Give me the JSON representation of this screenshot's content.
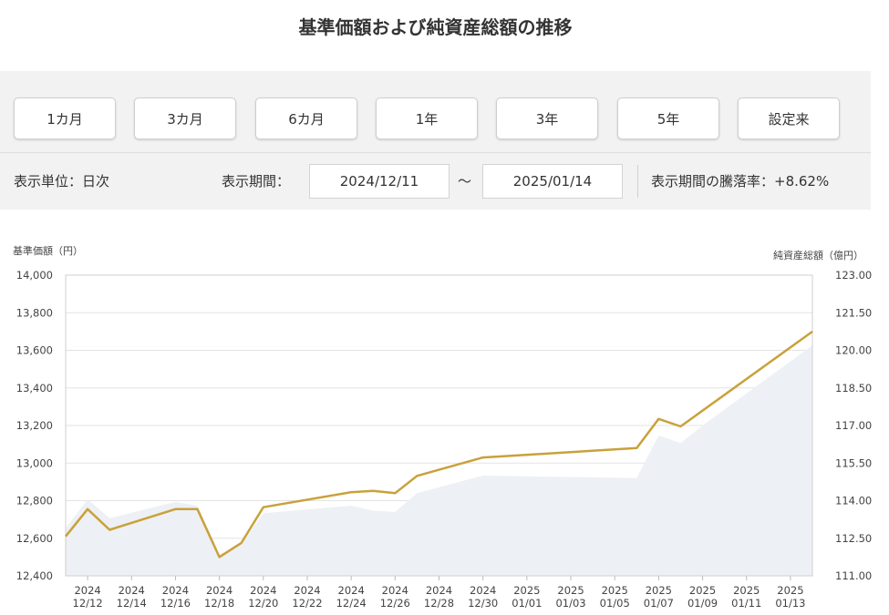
{
  "page": {
    "title": "基準価額および純資産総額の推移"
  },
  "period_buttons": [
    {
      "label": "1カ月"
    },
    {
      "label": "3カ月"
    },
    {
      "label": "6カ月"
    },
    {
      "label": "1年"
    },
    {
      "label": "3年"
    },
    {
      "label": "5年"
    },
    {
      "label": "設定来"
    }
  ],
  "controls": {
    "unit_label": "表示単位：日次",
    "period_label": "表示期間：",
    "start_date": "2024/12/11",
    "tilde": "～",
    "end_date": "2025/01/14",
    "change_label": "表示期間の騰落率：+8.62%"
  },
  "colors": {
    "nav_line": "#c9a13b",
    "net_assets_area": "#edf0f4",
    "grid": "#e3e3e3"
  },
  "chart_data": {
    "type": "line",
    "ylabel": "基準価額（円）",
    "y2label": "純資産総額（億円）",
    "ylim": [
      12400,
      14000
    ],
    "y2lim": [
      111.0,
      123.0
    ],
    "yticks": [
      "12,400",
      "12,600",
      "12,800",
      "13,000",
      "13,200",
      "13,400",
      "13,600",
      "13,800",
      "14,000"
    ],
    "y2ticks": [
      "111.00",
      "112.50",
      "114.00",
      "115.50",
      "117.00",
      "118.50",
      "120.00",
      "121.50",
      "123.00"
    ],
    "xticks": [
      {
        "date": "2024-12-12",
        "year": "2024",
        "md": "12/12"
      },
      {
        "date": "2024-12-14",
        "year": "2024",
        "md": "12/14"
      },
      {
        "date": "2024-12-16",
        "year": "2024",
        "md": "12/16"
      },
      {
        "date": "2024-12-18",
        "year": "2024",
        "md": "12/18"
      },
      {
        "date": "2024-12-20",
        "year": "2024",
        "md": "12/20"
      },
      {
        "date": "2024-12-22",
        "year": "2024",
        "md": "12/22"
      },
      {
        "date": "2024-12-24",
        "year": "2024",
        "md": "12/24"
      },
      {
        "date": "2024-12-26",
        "year": "2024",
        "md": "12/26"
      },
      {
        "date": "2024-12-28",
        "year": "2024",
        "md": "12/28"
      },
      {
        "date": "2024-12-30",
        "year": "2024",
        "md": "12/30"
      },
      {
        "date": "2025-01-01",
        "year": "2025",
        "md": "01/01"
      },
      {
        "date": "2025-01-03",
        "year": "2025",
        "md": "01/03"
      },
      {
        "date": "2025-01-05",
        "year": "2025",
        "md": "01/05"
      },
      {
        "date": "2025-01-07",
        "year": "2025",
        "md": "01/07"
      },
      {
        "date": "2025-01-09",
        "year": "2025",
        "md": "01/09"
      },
      {
        "date": "2025-01-11",
        "year": "2025",
        "md": "01/11"
      },
      {
        "date": "2025-01-13",
        "year": "2025",
        "md": "01/13"
      }
    ],
    "xrange": [
      "2024-12-11",
      "2025-01-14"
    ],
    "series": [
      {
        "name": "基準価額",
        "axis": "left",
        "kind": "line",
        "points": [
          {
            "x": "2024-12-11",
            "y": 12610
          },
          {
            "x": "2024-12-12",
            "y": 12755
          },
          {
            "x": "2024-12-13",
            "y": 12645
          },
          {
            "x": "2024-12-16",
            "y": 12755
          },
          {
            "x": "2024-12-17",
            "y": 12755
          },
          {
            "x": "2024-12-18",
            "y": 12500
          },
          {
            "x": "2024-12-19",
            "y": 12575
          },
          {
            "x": "2024-12-20",
            "y": 12765
          },
          {
            "x": "2024-12-24",
            "y": 12845
          },
          {
            "x": "2024-12-25",
            "y": 12852
          },
          {
            "x": "2024-12-26",
            "y": 12840
          },
          {
            "x": "2024-12-27",
            "y": 12932
          },
          {
            "x": "2024-12-30",
            "y": 13030
          },
          {
            "x": "2025-01-06",
            "y": 13080
          },
          {
            "x": "2025-01-07",
            "y": 13235
          },
          {
            "x": "2025-01-08",
            "y": 13195
          },
          {
            "x": "2025-01-14",
            "y": 13700
          }
        ]
      },
      {
        "name": "純資産総額",
        "axis": "right",
        "kind": "area",
        "points": [
          {
            "x": "2024-12-11",
            "y": 112.9
          },
          {
            "x": "2024-12-12",
            "y": 114.05
          },
          {
            "x": "2024-12-13",
            "y": 113.3
          },
          {
            "x": "2024-12-16",
            "y": 113.95
          },
          {
            "x": "2024-12-17",
            "y": 113.8
          },
          {
            "x": "2024-12-18",
            "y": 111.85
          },
          {
            "x": "2024-12-19",
            "y": 112.25
          },
          {
            "x": "2024-12-20",
            "y": 113.5
          },
          {
            "x": "2024-12-24",
            "y": 113.8
          },
          {
            "x": "2024-12-25",
            "y": 113.6
          },
          {
            "x": "2024-12-26",
            "y": 113.55
          },
          {
            "x": "2024-12-27",
            "y": 114.3
          },
          {
            "x": "2024-12-30",
            "y": 115.0
          },
          {
            "x": "2025-01-06",
            "y": 114.9
          },
          {
            "x": "2025-01-07",
            "y": 116.6
          },
          {
            "x": "2025-01-08",
            "y": 116.3
          },
          {
            "x": "2025-01-09",
            "y": 117.0
          },
          {
            "x": "2025-01-14",
            "y": 120.2
          }
        ]
      }
    ]
  }
}
